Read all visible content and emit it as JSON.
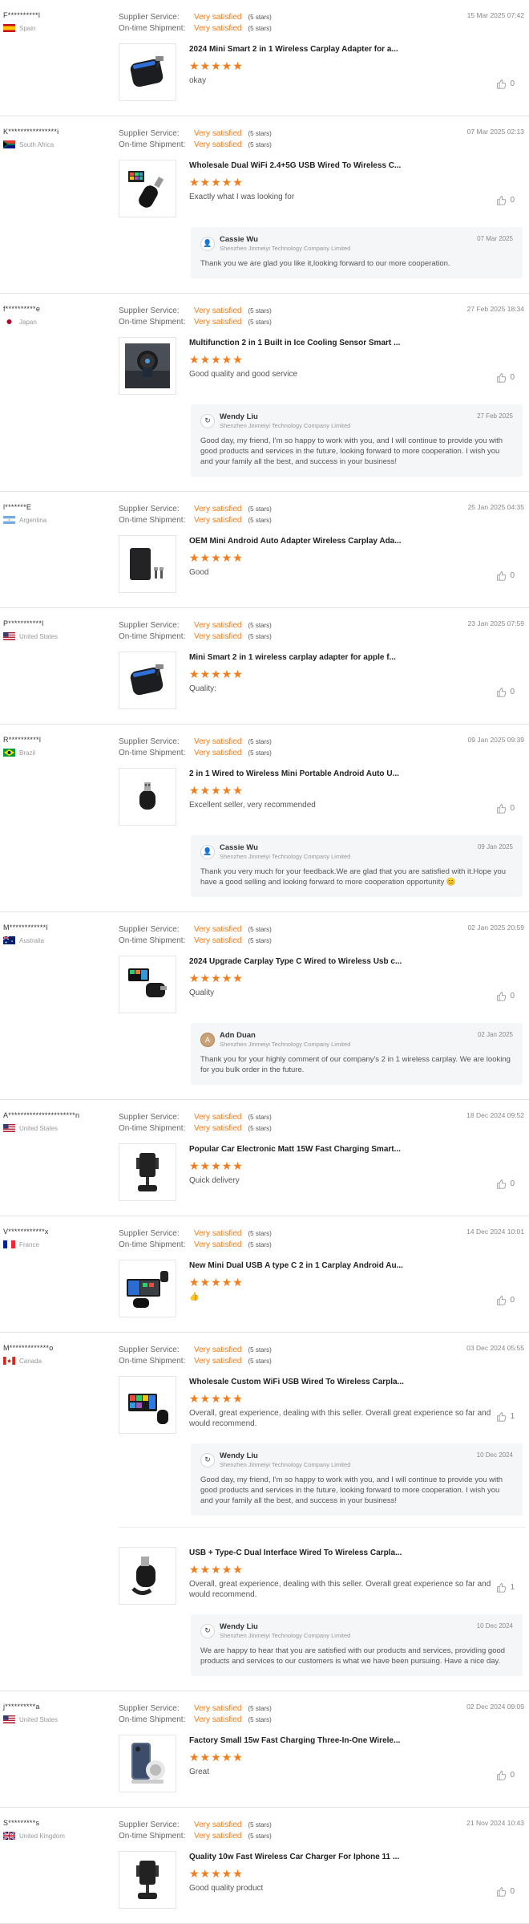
{
  "labels": {
    "supplier_service": "Supplier Service:",
    "on_time_shipment": "On-time Shipment:",
    "very_satisfied": "Very satisfied",
    "five_stars": "(5 stars)",
    "stars_glyph": "★★★★★"
  },
  "colors": {
    "accent": "#f07d1e",
    "divider": "#e4e4e4",
    "reply_bg": "#f5f6f7"
  },
  "reviews": [
    {
      "buyer": "F**********l",
      "country": "Spain",
      "flag": "spain",
      "date": "15 Mar 2025 07:42",
      "products": [
        {
          "image": "carplay-adapter-black",
          "title": "2024 Mini Smart 2 in 1 Wireless Carplay Adapter for a...",
          "text": "okay",
          "likes": "0",
          "reply": null
        }
      ]
    },
    {
      "buyer": "K****************i",
      "country": "South Africa",
      "flag": "south-africa",
      "date": "07 Mar 2025 02:13",
      "products": [
        {
          "image": "usb-dongle-screen",
          "title": "Wholesale Dual WiFi 2.4+5G USB Wired To Wireless C...",
          "text": "Exactly what I was looking for",
          "likes": "0",
          "reply": {
            "name": "Cassie Wu",
            "company": "Shenzhen Jinmeiyi Technology Company Limited",
            "date": "07 Mar 2025",
            "avatar": "cassie",
            "text": "Thank you we are glad you like it,looking forward to our more cooperation."
          }
        }
      ]
    },
    {
      "buyer": "f**********e",
      "country": "Japan",
      "flag": "japan",
      "date": "27 Feb 2025 18:34",
      "products": [
        {
          "image": "car-mount-cooling",
          "title": "Multifunction 2 in 1 Built in Ice Cooling Sensor Smart ...",
          "text": "Good quality and good service",
          "likes": "0",
          "reply": {
            "name": "Wendy Liu",
            "company": "Shenzhen Jinmeiyi Technology Company Limited",
            "date": "27 Feb 2025",
            "avatar": "wendy",
            "text": "Good day, my friend, I'm so happy to work with you, and I will continue to provide you with good products and services in the future, looking forward to more cooperation. I wish you and your family all the best, and success in your business!"
          }
        }
      ]
    },
    {
      "buyer": "l*******E",
      "country": "Argentina",
      "flag": "argentina",
      "date": "25 Jan 2025 04:35",
      "products": [
        {
          "image": "black-box-adapter",
          "title": "OEM Mini Android Auto Adapter Wireless Carplay Ada...",
          "text": "Good",
          "likes": "0",
          "reply": null
        }
      ]
    },
    {
      "buyer": "P***********l",
      "country": "United States",
      "flag": "usa",
      "date": "23 Jan 2025 07:59",
      "products": [
        {
          "image": "carplay-adapter-black",
          "title": "Mini Smart 2 in 1 wireless carplay adapter for apple f...",
          "text": "Quality:",
          "likes": "0",
          "reply": null
        }
      ]
    },
    {
      "buyer": "R**********l",
      "country": "Brazil",
      "flag": "brazil",
      "date": "09 Jan 2025 09:39",
      "products": [
        {
          "image": "usb-dongle-small",
          "title": "2 in 1 Wired to Wireless Mini Portable Android Auto U...",
          "text": "Excellent seller, very recommended",
          "likes": "0",
          "reply": {
            "name": "Cassie Wu",
            "company": "Shenzhen Jinmeiyi Technology Company Limited",
            "date": "09 Jan 2025",
            "avatar": "cassie",
            "text": "Thank you very much for your feedback.We are glad that you are satisfied with it.Hope you have a good selling and looking forward to more cooperation opportunity 😊"
          }
        }
      ]
    },
    {
      "buyer": "M************l",
      "country": "Australia",
      "flag": "australia",
      "date": "02 Jan 2025 20:59",
      "products": [
        {
          "image": "type-c-screen",
          "title": "2024 Upgrade Carplay Type C Wired to Wireless Usb c...",
          "text": "Quality",
          "likes": "0",
          "reply": {
            "name": "Adn Duan",
            "company": "Shenzhen Jinmeiyi Technology Company Limited",
            "date": "02 Jan 2025",
            "avatar": "adn",
            "text": "Thank you for your highly comment of our company's 2 in 1 wireless carplay. We are looking for you bulk order in the future."
          }
        }
      ]
    },
    {
      "buyer": "A**********************n",
      "country": "United States",
      "flag": "usa",
      "date": "18 Dec 2024 09:52",
      "products": [
        {
          "image": "phone-holder",
          "title": "Popular Car Electronic Matt 15W Fast Charging Smart...",
          "text": "Quick delivery",
          "likes": "0",
          "reply": null
        }
      ]
    },
    {
      "buyer": "V************x",
      "country": "France",
      "flag": "france",
      "date": "14 Dec 2024 10:01",
      "products": [
        {
          "image": "dual-usb-screen",
          "title": "New Mini Dual USB A type C 2 in 1 Carplay Android Au...",
          "text": "👍",
          "likes": "0",
          "reply": null
        }
      ]
    },
    {
      "buyer": "M*************o",
      "country": "Canada",
      "flag": "canada",
      "date": "03 Dec 2024 05:55",
      "products": [
        {
          "image": "wifi-usb-screen",
          "title": "Wholesale Custom WiFi USB Wired To Wireless Carpla...",
          "text": "Overall, great experience, dealing with this seller. Overall great experience so far and would recommend.",
          "likes": "1",
          "reply": {
            "name": "Wendy Liu",
            "company": "Shenzhen Jinmeiyi Technology Company Limited",
            "date": "10 Dec 2024",
            "avatar": "wendy",
            "text": "Good day, my friend, I'm so happy to work with you, and I will continue to provide you with good products and services in the future, looking forward to more cooperation. I wish you and your family all the best, and success in your business!"
          }
        },
        {
          "image": "usb-typec-dongle",
          "title": "USB + Type-C Dual Interface Wired To Wireless Carpla...",
          "text": "Overall, great experience, dealing with this seller. Overall great experience so far and would recommend.",
          "likes": "1",
          "reply": {
            "name": "Wendy Liu",
            "company": "Shenzhen Jinmeiyi Technology Company Limited",
            "date": "10 Dec 2024",
            "avatar": "wendy",
            "text": "We are happy to hear that you are satisfied with our products and services, providing good products and services to our customers is what we have been pursuing. Have a nice day."
          }
        }
      ]
    },
    {
      "buyer": "j**********a",
      "country": "United States",
      "flag": "usa",
      "date": "02 Dec 2024 09:09",
      "products": [
        {
          "image": "charger-stand",
          "title": "Factory Small 15w Fast Charging Three-In-One Wirele...",
          "text": "Great",
          "likes": "0",
          "reply": null
        }
      ]
    },
    {
      "buyer": "S*********s",
      "country": "United Kingdom",
      "flag": "uk",
      "date": "21 Nov 2024 10:43",
      "products": [
        {
          "image": "phone-holder",
          "title": "Quality 10w Fast Wireless Car Charger For Iphone 11 ...",
          "text": "Good quality product",
          "likes": "0",
          "reply": null
        }
      ]
    }
  ]
}
